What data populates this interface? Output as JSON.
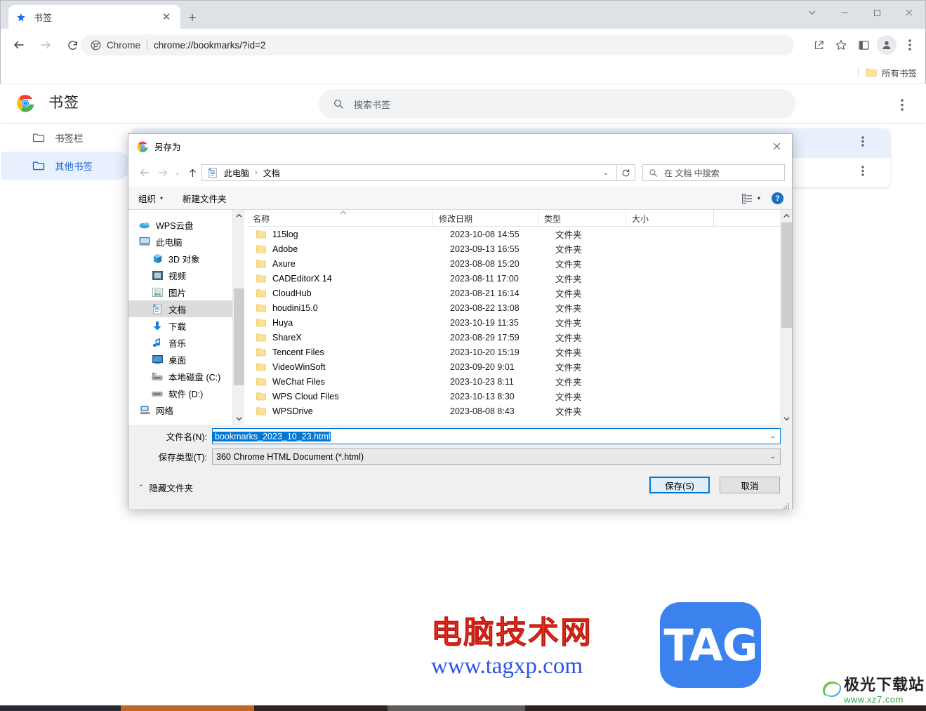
{
  "browser": {
    "tab": {
      "title": "书签",
      "favicon": "star-icon",
      "close": "✕"
    },
    "newtab_label": "+",
    "window_controls": {
      "minimize_group": "⌄",
      "minimize": "—",
      "maximize": "▢",
      "close": "✕"
    },
    "toolbar": {
      "back": "←",
      "forward": "→",
      "reload": "⟳",
      "omnibox_chip": "Chrome",
      "omnibox_url": "chrome://bookmarks/?id=2",
      "share": "share-icon",
      "star": "☆",
      "sidepanel": "side-panel-icon",
      "profile": "avatar-icon",
      "menu": "⋮"
    },
    "bookmark_bar": {
      "all_bookmarks_label": "所有书签"
    }
  },
  "bookmark_manager": {
    "title": "书签",
    "search_placeholder": "搜索书签",
    "more_menu": "⋮",
    "sidebar": [
      {
        "label": "书签栏",
        "active": false
      },
      {
        "label": "其他书签",
        "active": true
      }
    ],
    "rows": [
      {
        "selected": true,
        "menu": "⋮"
      },
      {
        "selected": false,
        "menu": "⋮"
      }
    ]
  },
  "dialog": {
    "title": "另存为",
    "close": "✕",
    "nav": {
      "back": "←",
      "forward": "→",
      "history_caret": "⌄",
      "up": "↑",
      "breadcrumbs": [
        "此电脑",
        "文档"
      ],
      "breadcrumb_sep": "›",
      "path_dropdown": "⌄",
      "refresh": "↻",
      "search_placeholder": "在 文档 中搜索"
    },
    "commandbar": {
      "organize": "组织",
      "organize_caret": "▾",
      "new_folder": "新建文件夹",
      "view_caret": "▾",
      "help": "?"
    },
    "tree": [
      {
        "label": "WPS云盘",
        "icon": "cloud-icon",
        "indent": false,
        "selected": false
      },
      {
        "label": "此电脑",
        "icon": "computer-icon",
        "indent": false,
        "selected": false
      },
      {
        "label": "3D 对象",
        "icon": "3d-objects-icon",
        "indent": true,
        "selected": false
      },
      {
        "label": "视频",
        "icon": "videos-icon",
        "indent": true,
        "selected": false
      },
      {
        "label": "图片",
        "icon": "pictures-icon",
        "indent": true,
        "selected": false
      },
      {
        "label": "文档",
        "icon": "documents-icon",
        "indent": true,
        "selected": true
      },
      {
        "label": "下载",
        "icon": "downloads-icon",
        "indent": true,
        "selected": false
      },
      {
        "label": "音乐",
        "icon": "music-icon",
        "indent": true,
        "selected": false
      },
      {
        "label": "桌面",
        "icon": "desktop-icon",
        "indent": true,
        "selected": false
      },
      {
        "label": "本地磁盘 (C:)",
        "icon": "system-drive-icon",
        "indent": true,
        "selected": false
      },
      {
        "label": "软件 (D:)",
        "icon": "drive-icon",
        "indent": true,
        "selected": false
      },
      {
        "label": "网络",
        "icon": "network-icon",
        "indent": false,
        "selected": false
      }
    ],
    "columns": [
      "名称",
      "修改日期",
      "类型",
      "大小"
    ],
    "files": [
      {
        "name": "115log",
        "date": "2023-10-08 14:55",
        "type": "文件夹",
        "size": ""
      },
      {
        "name": "Adobe",
        "date": "2023-09-13 16:55",
        "type": "文件夹",
        "size": ""
      },
      {
        "name": "Axure",
        "date": "2023-08-08 15:20",
        "type": "文件夹",
        "size": ""
      },
      {
        "name": "CADEditorX 14",
        "date": "2023-08-11 17:00",
        "type": "文件夹",
        "size": ""
      },
      {
        "name": "CloudHub",
        "date": "2023-08-21 16:14",
        "type": "文件夹",
        "size": ""
      },
      {
        "name": "houdini15.0",
        "date": "2023-08-22 13:08",
        "type": "文件夹",
        "size": ""
      },
      {
        "name": "Huya",
        "date": "2023-10-19 11:35",
        "type": "文件夹",
        "size": ""
      },
      {
        "name": "ShareX",
        "date": "2023-08-29 17:59",
        "type": "文件夹",
        "size": ""
      },
      {
        "name": "Tencent Files",
        "date": "2023-10-20 15:19",
        "type": "文件夹",
        "size": ""
      },
      {
        "name": "VideoWinSoft",
        "date": "2023-09-20 9:01",
        "type": "文件夹",
        "size": ""
      },
      {
        "name": "WeChat Files",
        "date": "2023-10-23 8:11",
        "type": "文件夹",
        "size": ""
      },
      {
        "name": "WPS Cloud Files",
        "date": "2023-10-13 8:30",
        "type": "文件夹",
        "size": ""
      },
      {
        "name": "WPSDrive",
        "date": "2023-08-08 8:43",
        "type": "文件夹",
        "size": ""
      }
    ],
    "fields": {
      "filename_label": "文件名(N):",
      "filename_value": "bookmarks_2023_10_23.html",
      "filetype_label": "保存类型(T):",
      "filetype_value": "360 Chrome HTML Document (*.html)",
      "caret": "⌄"
    },
    "footer": {
      "hide_folders": "隐藏文件夹",
      "hide_folders_caret": "⌃",
      "save": "保存(S)",
      "cancel": "取消"
    }
  },
  "watermarks": {
    "main_cn": "电脑技术网",
    "main_url": "www.tagxp.com",
    "logo_text": "TAG",
    "corner_cn": "极光下载站",
    "corner_url": "www.xz7.com"
  },
  "colors": {
    "accent_blue": "#1a73e8",
    "selection_blue": "#0078d7",
    "sidebar_selected": "#e8f0fe",
    "tab_strip": "#dee1e6",
    "dialog_bg": "#f0f0f0",
    "watermark_red": "#e8301c",
    "watermark_blue": "#2a55e8",
    "tag_blue": "#3b82ef"
  }
}
